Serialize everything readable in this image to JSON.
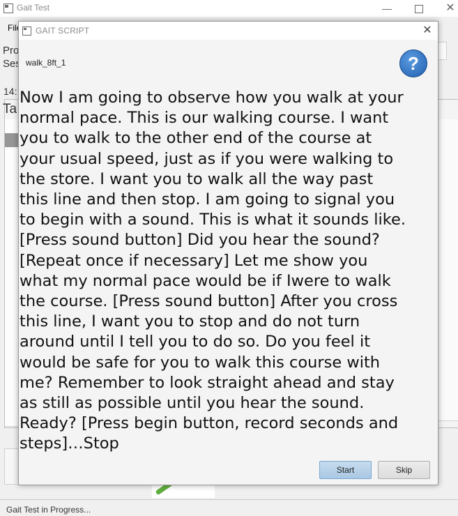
{
  "main_window": {
    "title": "Gait Test",
    "min_glyph": "—",
    "close_glyph": "✕",
    "menu_file": "File",
    "label_pro": "Pro",
    "label_ses": "Ses",
    "label_time": "14:",
    "label_tab": "Ta"
  },
  "dialog": {
    "title": "GAIT SCRIPT",
    "close_glyph": "✕",
    "script_name": "walk_8ft_1",
    "help_label": "?",
    "script_lines": [
      "Now I am going to observe how you walk at your",
      "normal pace. This is our walking course. I want",
      "you to walk to the other end of the course at",
      "your usual speed, just as if you were walking to",
      "the store. I want you to walk all the way past",
      "this line and then stop. I am going to signal you",
      "to begin with a sound. This is what it sounds like.",
      "[Press sound button] Did you hear the sound?",
      "[Repeat once if necessary] Let me show you",
      "what my normal pace would be if Iwere to walk",
      "the course. [Press sound button] After you cross",
      "this line, I want you to stop and do not turn",
      "around until I tell you to do so. Do you feel it",
      "would be safe for you to walk this course with",
      "me? Remember to look straight ahead and stay",
      "as still as possible until you hear the sound.",
      "Ready? [Press begin button, record seconds and",
      "steps]…Stop"
    ],
    "start_label": "Start",
    "skip_label": "Skip"
  },
  "status_bar": {
    "text": "Gait Test in Progress..."
  },
  "icons": {
    "app": "window-app-icon",
    "help": "help-question-icon"
  },
  "colors": {
    "start_button": "#a9c8e3",
    "help_button": "#1f5fb0"
  }
}
